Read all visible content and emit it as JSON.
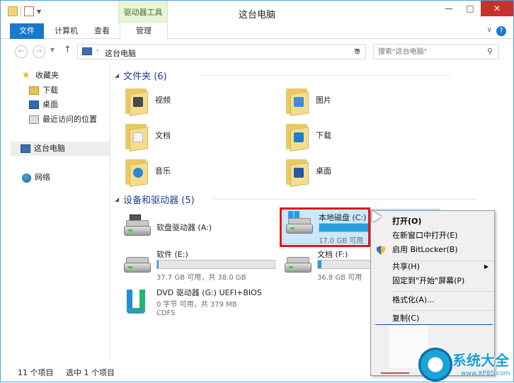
{
  "window": {
    "title": "这台电脑",
    "context_tab_header": "驱动器工具"
  },
  "ribbon": {
    "tabs": [
      {
        "label": "文件"
      },
      {
        "label": "计算机"
      },
      {
        "label": "查看"
      },
      {
        "label": "管理"
      }
    ]
  },
  "address": {
    "path": "这台电脑",
    "search_placeholder": "搜索\"这台电脑\""
  },
  "nav_pane": {
    "favorites": "收藏夹",
    "downloads": "下载",
    "desktop": "桌面",
    "recent": "最近访问的位置",
    "this_pc": "这台电脑",
    "network": "网络"
  },
  "content": {
    "folders_header": "文件夹 (6)",
    "folders": [
      {
        "label": "视频",
        "icon": "video-folder-icon"
      },
      {
        "label": "图片",
        "icon": "pictures-folder-icon"
      },
      {
        "label": "文档",
        "icon": "documents-folder-icon"
      },
      {
        "label": "下载",
        "icon": "downloads-folder-icon"
      },
      {
        "label": "音乐",
        "icon": "music-folder-icon"
      },
      {
        "label": "桌面",
        "icon": "desktop-folder-icon"
      }
    ],
    "devices_header": "设备和驱动器 (5)",
    "drives": {
      "floppy": {
        "name": "软盘驱动器 (A:)"
      },
      "c": {
        "name": "本地磁盘 (C:)",
        "info": "17.0 GB 可用",
        "used_fraction": 0.6
      },
      "e": {
        "name": "软件 (E:)",
        "info": "37.7 GB 可用，共 38.0 GB",
        "used_fraction": 0.01
      },
      "f": {
        "name": "文档 (F:)",
        "info": "36.8 GB 可用",
        "used_fraction": 0.03
      },
      "dvd": {
        "name": "DVD 驱动器 (G:) UEFI+BIOS",
        "info": "0 字节 可用，共 379 MB",
        "fs": "CDFS"
      }
    }
  },
  "status_bar": {
    "item_count": "11 个项目",
    "selected": "选中 1 个项目"
  },
  "context_menu": {
    "items": [
      {
        "label": "打开(O)",
        "bold": true
      },
      {
        "label": "在新窗口中打开(E)"
      },
      {
        "label": "启用 BitLocker(B)"
      },
      {
        "label": "共享(H)"
      },
      {
        "label": "固定到\"开始\"屏幕(P)"
      },
      {
        "label": "格式化(A)..."
      },
      {
        "label": "复制(C)"
      }
    ]
  },
  "watermark": {
    "text": "系统大全",
    "url": "www.XP85.com"
  },
  "colors": {
    "accent": "#1979ca",
    "highlight_red": "#e0161b",
    "drive_bar": "#26a0da",
    "close_button": "#c7312c"
  }
}
